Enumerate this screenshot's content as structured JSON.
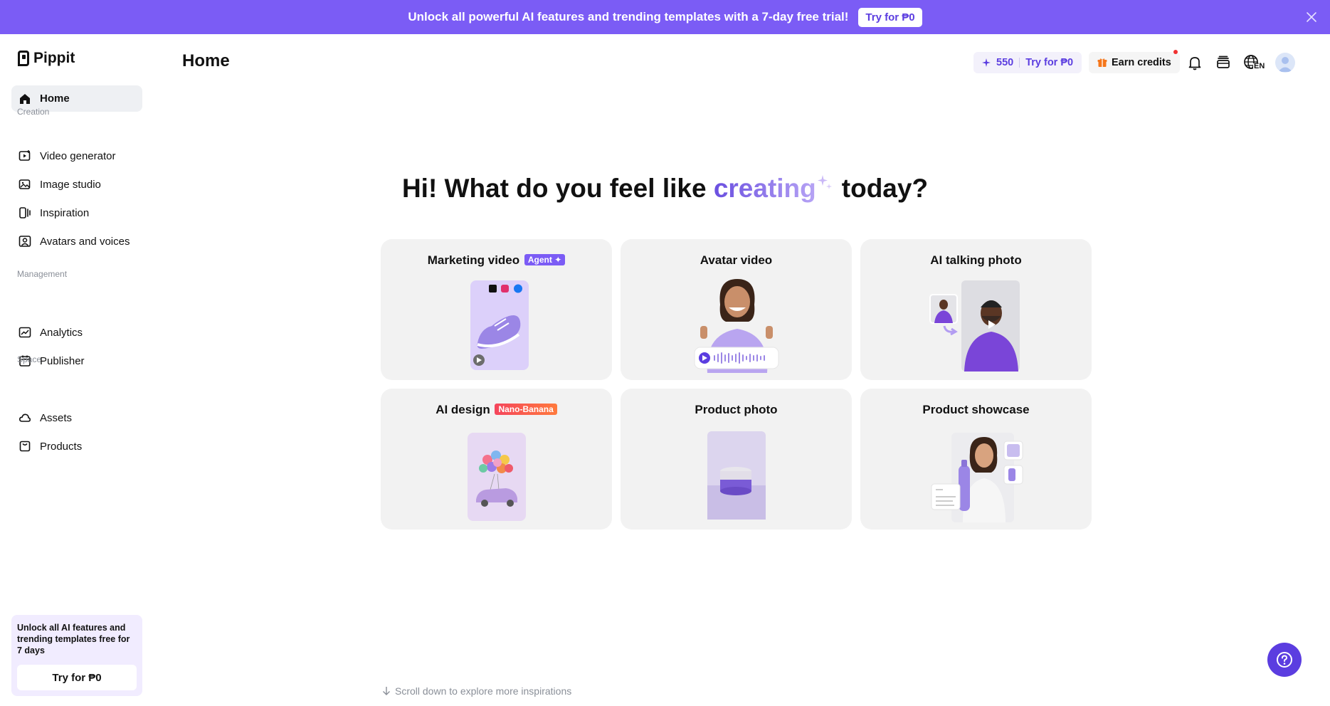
{
  "banner": {
    "message": "Unlock all powerful AI features and trending templates with a 7-day free trial!",
    "cta_label": "Try for ₱0"
  },
  "sidebar": {
    "brand": "Pippit",
    "home_label": "Home",
    "sections": {
      "creation": "Creation",
      "management": "Management",
      "space": "Space"
    },
    "items": [
      {
        "label": "Video generator",
        "icon": "video-generator-icon"
      },
      {
        "label": "Image studio",
        "icon": "image-studio-icon"
      },
      {
        "label": "Inspiration",
        "icon": "inspiration-icon"
      },
      {
        "label": "Avatars and voices",
        "icon": "avatar-voice-icon"
      },
      {
        "label": "Analytics",
        "icon": "analytics-icon"
      },
      {
        "label": "Publisher",
        "icon": "calendar-icon"
      },
      {
        "label": "Assets",
        "icon": "cloud-icon"
      },
      {
        "label": "Products",
        "icon": "product-icon"
      }
    ],
    "promo": {
      "text": "Unlock all AI features and trending templates free for 7 days",
      "button_label": "Try for ₱0"
    }
  },
  "header": {
    "title": "Home",
    "credits": "550",
    "credits_cta": "Try for ₱0",
    "earn_label": "Earn credits",
    "language": "EN"
  },
  "hero": {
    "before": "Hi! What do you feel like",
    "accent": "creating",
    "after": "today?"
  },
  "cards": [
    {
      "title": "Marketing video",
      "badge": "Agent ✦"
    },
    {
      "title": "Avatar video",
      "badge": ""
    },
    {
      "title": "AI talking photo",
      "badge": ""
    },
    {
      "title": "AI design",
      "badge": "Nano-Banana"
    },
    {
      "title": "Product photo",
      "badge": ""
    },
    {
      "title": "Product showcase",
      "badge": ""
    }
  ],
  "scroll_hint": "Scroll down to explore more inspirations",
  "colors": {
    "brand": "#7B5CF5",
    "accent_dark": "#5B3DE0",
    "card_bg": "#F2F2F2"
  }
}
